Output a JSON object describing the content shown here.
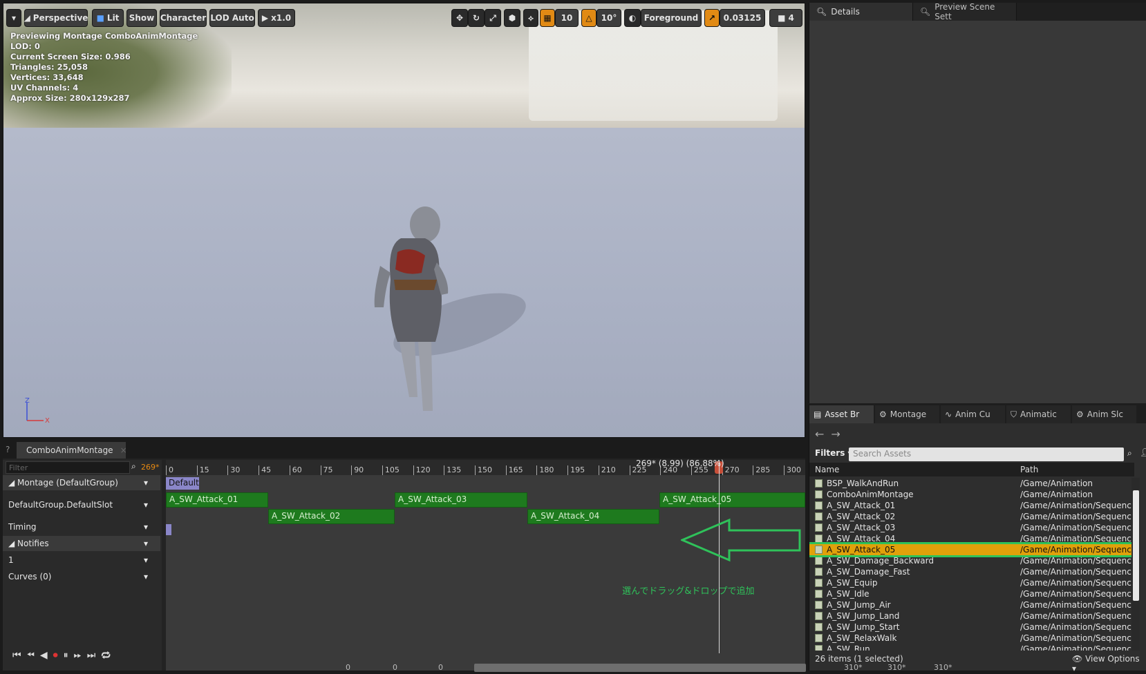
{
  "viewport": {
    "toolbar": {
      "perspective": "Perspective",
      "lit": "Lit",
      "show": "Show",
      "character": "Character",
      "lod": "LOD Auto",
      "speed": "x1.0",
      "grid_snap": "10",
      "rot_snap": "10°",
      "foreground": "Foreground",
      "scale_snap": "0.03125",
      "cam_speed": "4"
    },
    "stats": [
      "Previewing Montage ComboAnimMontage",
      "LOD: 0",
      "Current Screen Size: 0.986",
      "Triangles: 25,058",
      "Vertices: 33,648",
      "UV Channels: 4",
      "Approx Size: 280x129x287"
    ],
    "axis": {
      "z": "Z",
      "x": "X"
    }
  },
  "details": {
    "tabs": [
      {
        "label": "Details",
        "icon": "magnifier-icon"
      },
      {
        "label": "Preview Scene Sett",
        "icon": "magnifier-icon"
      }
    ]
  },
  "asset_browser": {
    "tabs": [
      "Asset Br",
      "Montage",
      "Anim Cu",
      "Animatic",
      "Anim Slc"
    ],
    "filters": "Filters",
    "search_placeholder": "Search Assets",
    "col_name": "Name",
    "col_path": "Path",
    "rows": [
      {
        "name": "BSP_WalkAndRun",
        "path": "/Game/Animation"
      },
      {
        "name": "ComboAnimMontage",
        "path": "/Game/Animation"
      },
      {
        "name": "A_SW_Attack_01",
        "path": "/Game/Animation/Sequence"
      },
      {
        "name": "A_SW_Attack_02",
        "path": "/Game/Animation/Sequence"
      },
      {
        "name": "A_SW_Attack_03",
        "path": "/Game/Animation/Sequence"
      },
      {
        "name": "A_SW_Attack_04",
        "path": "/Game/Animation/Sequence"
      },
      {
        "name": "A_SW_Attack_05",
        "path": "/Game/Animation/Sequence",
        "selected": true
      },
      {
        "name": "A_SW_Damage_Backward",
        "path": "/Game/Animation/Sequence"
      },
      {
        "name": "A_SW_Damage_Fast",
        "path": "/Game/Animation/Sequence"
      },
      {
        "name": "A_SW_Equip",
        "path": "/Game/Animation/Sequence"
      },
      {
        "name": "A_SW_Idle",
        "path": "/Game/Animation/Sequence"
      },
      {
        "name": "A_SW_Jump_Air",
        "path": "/Game/Animation/Sequence"
      },
      {
        "name": "A_SW_Jump_Land",
        "path": "/Game/Animation/Sequence"
      },
      {
        "name": "A_SW_Jump_Start",
        "path": "/Game/Animation/Sequence"
      },
      {
        "name": "A_SW_RelaxWalk",
        "path": "/Game/Animation/Sequence"
      },
      {
        "name": "A_SW_Run",
        "path": "/Game/Animation/Sequence"
      }
    ],
    "status": "26 items (1 selected)",
    "view_options": "View Options"
  },
  "montage": {
    "tab": "ComboAnimMontage",
    "filter_placeholder": "Filter",
    "current_frame": "269*",
    "tracks": [
      {
        "label": "Montage (DefaultGroup)",
        "header": true
      },
      {
        "label": "DefaultGroup.DefaultSlot",
        "header": false
      },
      {
        "label": "Timing",
        "header": false
      },
      {
        "label": "Notifies",
        "header": true
      },
      {
        "label": "1",
        "header": false
      },
      {
        "label": "Curves  (0)",
        "header": false
      }
    ],
    "ruler": [
      "0",
      "15",
      "30",
      "45",
      "60",
      "75",
      "90",
      "105",
      "120",
      "135",
      "150",
      "165",
      "180",
      "195",
      "210",
      "225",
      "240",
      "255",
      "270",
      "285",
      "300"
    ],
    "playhead_label": "269* (8.99) (86.88%)",
    "default_section": "Default",
    "segments_row1": [
      "A_SW_Attack_01",
      "A_SW_Attack_03",
      "A_SW_Attack_05"
    ],
    "segments_row2": [
      "A_SW_Attack_02",
      "A_SW_Attack_04"
    ],
    "annotation": "選んでドラッグ&ドロップで追加",
    "bottom": [
      "0",
      "0",
      "0",
      "310*",
      "310*",
      "310*"
    ]
  }
}
